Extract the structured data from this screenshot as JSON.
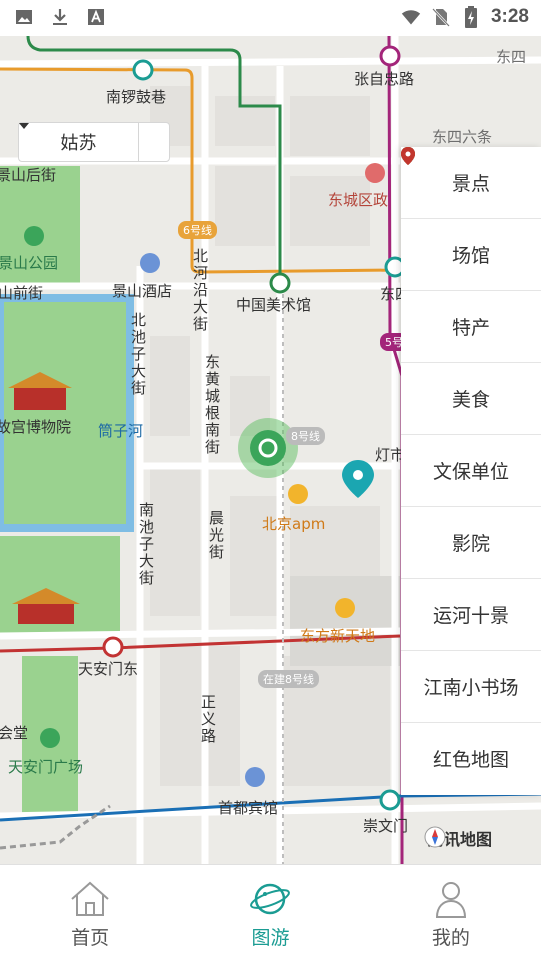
{
  "status_bar": {
    "time": "3:28"
  },
  "city_select": {
    "value": "姑苏"
  },
  "categories": [
    {
      "label": "景点",
      "color": "#1f9a55"
    },
    {
      "label": "场馆",
      "color": "#3a6fd6"
    },
    {
      "label": "特产",
      "color": "#c2362e"
    },
    {
      "label": "美食",
      "color": "#e8762b"
    },
    {
      "label": "文保单位",
      "color": "#1aaab8"
    },
    {
      "label": "影院",
      "color": "#8d4fc4"
    },
    {
      "label": "运河十景",
      "color": "#e0447a"
    },
    {
      "label": "江南小书场",
      "color": "#b8860b"
    },
    {
      "label": "红色地图",
      "color": "#c2362e"
    }
  ],
  "map_labels": {
    "nanluoguxiang": "南锣鼓巷",
    "zhangzizhonglu": "张自忠路",
    "dongsi": "东四",
    "dongsiliutiao": "东四六条",
    "jingshanhoujie": "景山后街",
    "dongchengqu": "东城区政",
    "jingshangongyuan": "景山公园",
    "line6": "6号线",
    "jingshanqianjie": "山前街",
    "jingshanjiudian": "景山酒店",
    "beiheyan": "北河沿大街",
    "zhongguomeishuguan": "中国美术馆",
    "dong": "东四",
    "beichizi": "北池子大街",
    "line5": "5号",
    "donghuangcheng": "东黄城根南街",
    "gugong": "故宫博物院",
    "tongzihe": "筒子河",
    "line8": "8号线",
    "dengshi": "灯市",
    "beijingapm": "北京apm",
    "nanchizi": "南池子大街",
    "chenguang": "晨光街",
    "dongfangxintiandi": "东方新天地",
    "tiananmendong": "天安门东",
    "zaijian8": "在建8号线",
    "zhengyilu": "正义路",
    "huitang": "会堂",
    "tiananmenguangchang": "天安门广场",
    "shoudubinguan": "首都宾馆",
    "chongwenmen": "崇文门",
    "tencent": "腾讯地图"
  },
  "tabs": [
    {
      "label": "首页"
    },
    {
      "label": "图游"
    },
    {
      "label": "我的"
    }
  ]
}
